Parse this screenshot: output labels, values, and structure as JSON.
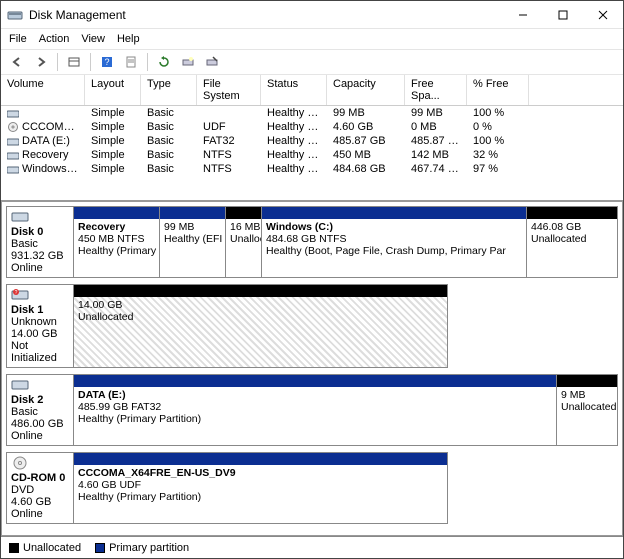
{
  "window": {
    "title": "Disk Management"
  },
  "menu": {
    "file": "File",
    "action": "Action",
    "view": "View",
    "help": "Help"
  },
  "columns": {
    "volume": "Volume",
    "layout": "Layout",
    "type": "Type",
    "fs": "File System",
    "status": "Status",
    "capacity": "Capacity",
    "free": "Free Spa...",
    "pctfree": "% Free"
  },
  "volumes": [
    {
      "name": "",
      "layout": "Simple",
      "type": "Basic",
      "fs": "",
      "status": "Healthy (E...",
      "capacity": "99 MB",
      "free": "99 MB",
      "pct": "100 %",
      "icon": "vol"
    },
    {
      "name": "CCCOMA_X64FRE...",
      "layout": "Simple",
      "type": "Basic",
      "fs": "UDF",
      "status": "Healthy (P...",
      "capacity": "4.60 GB",
      "free": "0 MB",
      "pct": "0 %",
      "icon": "dvd"
    },
    {
      "name": "DATA (E:)",
      "layout": "Simple",
      "type": "Basic",
      "fs": "FAT32",
      "status": "Healthy (P...",
      "capacity": "485.87 GB",
      "free": "485.87 GB",
      "pct": "100 %",
      "icon": "vol"
    },
    {
      "name": "Recovery",
      "layout": "Simple",
      "type": "Basic",
      "fs": "NTFS",
      "status": "Healthy (P...",
      "capacity": "450 MB",
      "free": "142 MB",
      "pct": "32 %",
      "icon": "vol"
    },
    {
      "name": "Windows (C:)",
      "layout": "Simple",
      "type": "Basic",
      "fs": "NTFS",
      "status": "Healthy (B...",
      "capacity": "484.68 GB",
      "free": "467.74 GB",
      "pct": "97 %",
      "icon": "vol"
    }
  ],
  "disks": {
    "d0": {
      "label": "Disk 0",
      "type": "Basic",
      "size": "931.32 GB",
      "status": "Online",
      "parts": {
        "p0": {
          "title": "Recovery",
          "line2": "450 MB NTFS",
          "line3": "Healthy (Primary Part"
        },
        "p1": {
          "title": "",
          "line2": "99 MB",
          "line3": "Healthy (EFI Sys"
        },
        "p2": {
          "title": "",
          "line2": "16 MB",
          "line3": "Unalloca"
        },
        "p3": {
          "title": "Windows  (C:)",
          "line2": "484.68 GB NTFS",
          "line3": "Healthy (Boot, Page File, Crash Dump, Primary Par"
        },
        "p4": {
          "title": "",
          "line2": "446.08 GB",
          "line3": "Unallocated"
        }
      }
    },
    "d1": {
      "label": "Disk 1",
      "type": "Unknown",
      "size": "14.00 GB",
      "status": "Not Initialized",
      "parts": {
        "p0": {
          "title": "",
          "line2": "14.00 GB",
          "line3": "Unallocated"
        }
      }
    },
    "d2": {
      "label": "Disk 2",
      "type": "Basic",
      "size": "486.00 GB",
      "status": "Online",
      "parts": {
        "p0": {
          "title": "DATA  (E:)",
          "line2": "485.99 GB FAT32",
          "line3": "Healthy (Primary Partition)"
        },
        "p1": {
          "title": "",
          "line2": "9 MB",
          "line3": "Unallocated"
        }
      }
    },
    "cd0": {
      "label": "CD-ROM 0",
      "type": "DVD",
      "size": "4.60 GB",
      "status": "Online",
      "parts": {
        "p0": {
          "title": "CCCOMA_X64FRE_EN-US_DV9",
          "line2": "4.60 GB UDF",
          "line3": "Healthy (Primary Partition)"
        }
      }
    }
  },
  "legend": {
    "unalloc": "Unallocated",
    "primary": "Primary partition"
  }
}
